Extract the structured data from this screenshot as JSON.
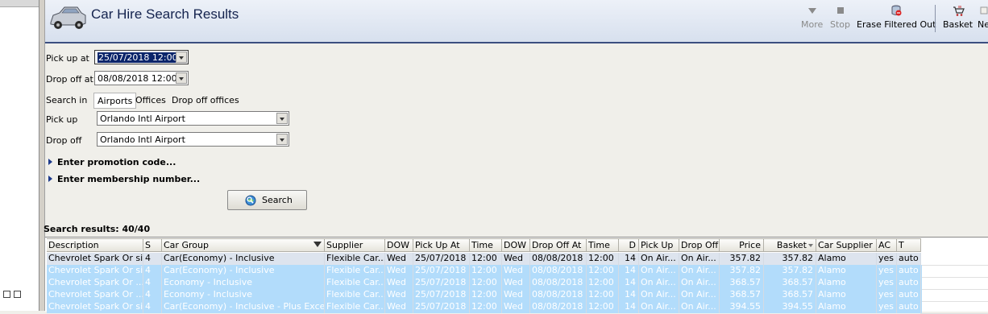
{
  "header": {
    "title": "Car Hire Search Results",
    "toolbar": [
      {
        "label": "More",
        "icon": "arrow-down-icon",
        "enabled": false
      },
      {
        "label": "Stop",
        "icon": "stop-icon",
        "enabled": false
      },
      {
        "label": "Erase Filtered Out",
        "icon": "erase-filter-icon",
        "enabled": true
      },
      {
        "label": "Basket",
        "icon": "basket-icon",
        "enabled": true
      },
      {
        "label": "Ne",
        "icon": "new-icon",
        "enabled": true
      }
    ]
  },
  "form": {
    "pickup_at_label": "Pick up at",
    "pickup_at_value": "25/07/2018 12:00",
    "dropoff_at_label": "Drop off at",
    "dropoff_at_value": "08/08/2018 12:00",
    "search_in_label": "Search in",
    "search_in_options": [
      "Airports",
      "Offices",
      "Drop off offices"
    ],
    "search_in_selected": "Airports",
    "pickup_label": "Pick up",
    "pickup_value": "Orlando Intl Airport",
    "dropoff_label": "Drop off",
    "dropoff_value": "Orlando Intl Airport",
    "promo_label": "Enter promotion code...",
    "membership_label": "Enter membership number...",
    "search_button": "Search"
  },
  "results": {
    "label": "Search results: 40/40",
    "columns": [
      "Description",
      "S",
      "Car Group",
      "Supplier",
      "DOW",
      "Pick Up At",
      "Time",
      "DOW",
      "Drop Off At",
      "Time",
      "D",
      "Pick Up",
      "Drop Off",
      "Price",
      "Basket",
      "Car Supplier",
      "AC",
      "T"
    ],
    "rows": [
      [
        "Chevrolet Spark Or si...",
        "4",
        "Car(Economy) - Inclusive",
        "Flexible Car...",
        "Wed",
        "25/07/2018",
        "12:00",
        "Wed",
        "08/08/2018",
        "12:00",
        "14",
        "On Air...",
        "On Air...",
        "357.82",
        "357.82",
        "Alamo",
        "yes",
        "auto"
      ],
      [
        "Chevrolet Spark Or si...",
        "4",
        "Car(Economy) - Inclusive",
        "Flexible Car...",
        "Wed",
        "25/07/2018",
        "12:00",
        "Wed",
        "08/08/2018",
        "12:00",
        "14",
        "On Air...",
        "On Air...",
        "357.82",
        "357.82",
        "Alamo",
        "yes",
        "auto"
      ],
      [
        "Chevrolet  Spark Or ...",
        "4",
        "Economy - Inclusive",
        "Flexible Car...",
        "Wed",
        "25/07/2018",
        "12:00",
        "Wed",
        "08/08/2018",
        "12:00",
        "14",
        "On Air...",
        "On Air...",
        "368.57",
        "368.57",
        "Alamo",
        "yes",
        "auto"
      ],
      [
        "Chevrolet  Spark Or ...",
        "4",
        "Economy - Inclusive",
        "Flexible Car...",
        "Wed",
        "25/07/2018",
        "12:00",
        "Wed",
        "08/08/2018",
        "12:00",
        "14",
        "On Air...",
        "On Air...",
        "368.57",
        "368.57",
        "Alamo",
        "yes",
        "auto"
      ],
      [
        "Chevrolet Spark Or si...",
        "4",
        "Car(Economy) - Inclusive - Plus Exces...",
        "Flexible Car...",
        "Wed",
        "25/07/2018",
        "12:00",
        "Wed",
        "08/08/2018",
        "12:00",
        "14",
        "On Air...",
        "On Air...",
        "394.55",
        "394.55",
        "Alamo",
        "yes",
        "auto"
      ]
    ]
  },
  "colors": {
    "header_text": "#14234e",
    "selected_row": "#b2dcfb",
    "first_row": "#dde4ee",
    "selection_highlight": "#0a246a"
  }
}
